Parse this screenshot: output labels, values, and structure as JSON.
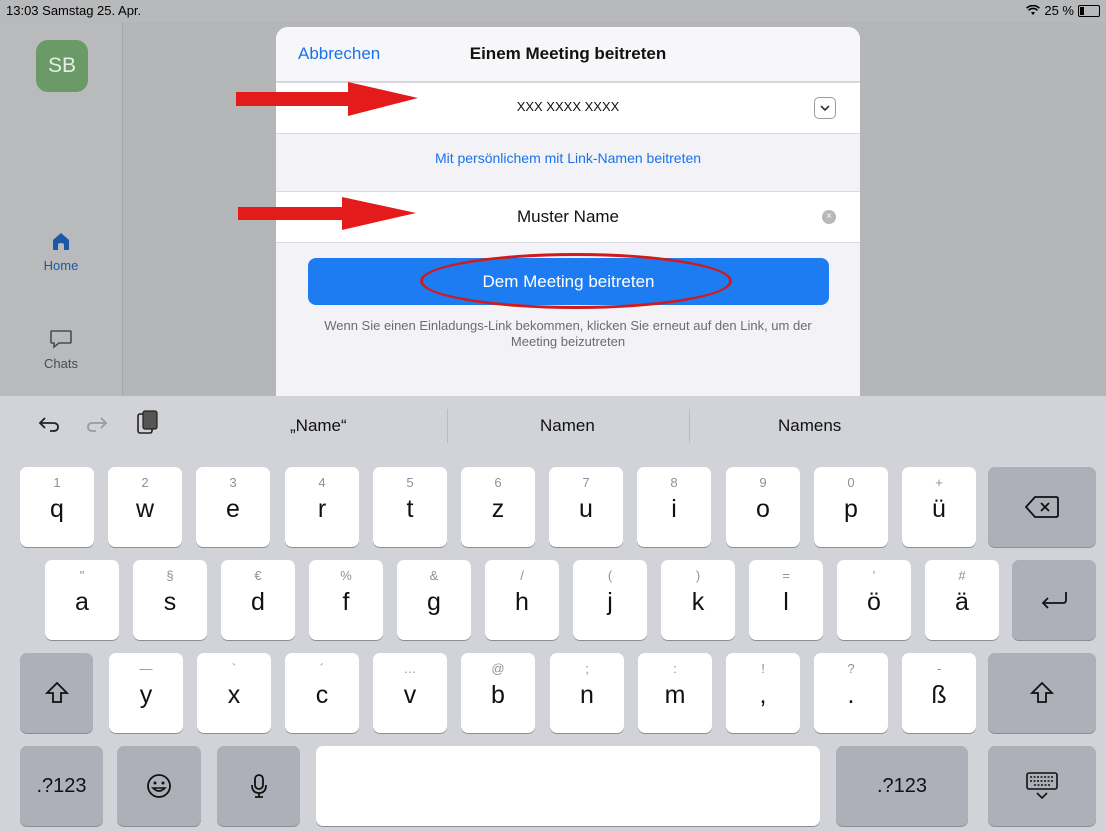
{
  "status": {
    "time_date": "13:03  Samstag 25. Apr.",
    "battery": "25 %"
  },
  "sidebar": {
    "avatar": "SB",
    "items": [
      {
        "label": "Home"
      },
      {
        "label": "Chats"
      }
    ]
  },
  "modal": {
    "cancel": "Abbrechen",
    "title": "Einem Meeting beitreten",
    "meeting_id": "XXX XXXX XXXX",
    "personal_link": "Mit persönlichem mit Link-Namen beitreten",
    "name_value": "Muster Name",
    "join_button": "Dem Meeting beitreten",
    "hint": "Wenn Sie einen Einladungs-Link bekommen, klicken Sie erneut auf den Link, um der Meeting beizutreten"
  },
  "keyboard": {
    "suggestions": [
      "„Name“",
      "Namen",
      "Namens"
    ],
    "row1": [
      {
        "sub": "1",
        "key": "q"
      },
      {
        "sub": "2",
        "key": "w"
      },
      {
        "sub": "3",
        "key": "e"
      },
      {
        "sub": "4",
        "key": "r"
      },
      {
        "sub": "5",
        "key": "t"
      },
      {
        "sub": "6",
        "key": "z"
      },
      {
        "sub": "7",
        "key": "u"
      },
      {
        "sub": "8",
        "key": "i"
      },
      {
        "sub": "9",
        "key": "o"
      },
      {
        "sub": "0",
        "key": "p"
      },
      {
        "sub": "+",
        "key": "ü"
      }
    ],
    "row2": [
      {
        "sub": "\"",
        "key": "a"
      },
      {
        "sub": "§",
        "key": "s"
      },
      {
        "sub": "€",
        "key": "d"
      },
      {
        "sub": "%",
        "key": "f"
      },
      {
        "sub": "&",
        "key": "g"
      },
      {
        "sub": "/",
        "key": "h"
      },
      {
        "sub": "(",
        "key": "j"
      },
      {
        "sub": ")",
        "key": "k"
      },
      {
        "sub": "=",
        "key": "l"
      },
      {
        "sub": "’",
        "key": "ö"
      },
      {
        "sub": "#",
        "key": "ä"
      }
    ],
    "row3": [
      {
        "sub": "—",
        "key": "y"
      },
      {
        "sub": "`",
        "key": "x"
      },
      {
        "sub": "´",
        "key": "c"
      },
      {
        "sub": "…",
        "key": "v"
      },
      {
        "sub": "@",
        "key": "b"
      },
      {
        "sub": ";",
        "key": "n"
      },
      {
        "sub": ":",
        "key": "m"
      },
      {
        "sub": "!",
        "key": ","
      },
      {
        "sub": "?",
        "key": "."
      },
      {
        "sub": "-",
        "key": "ß"
      }
    ],
    "numbers_label": ".?123"
  }
}
